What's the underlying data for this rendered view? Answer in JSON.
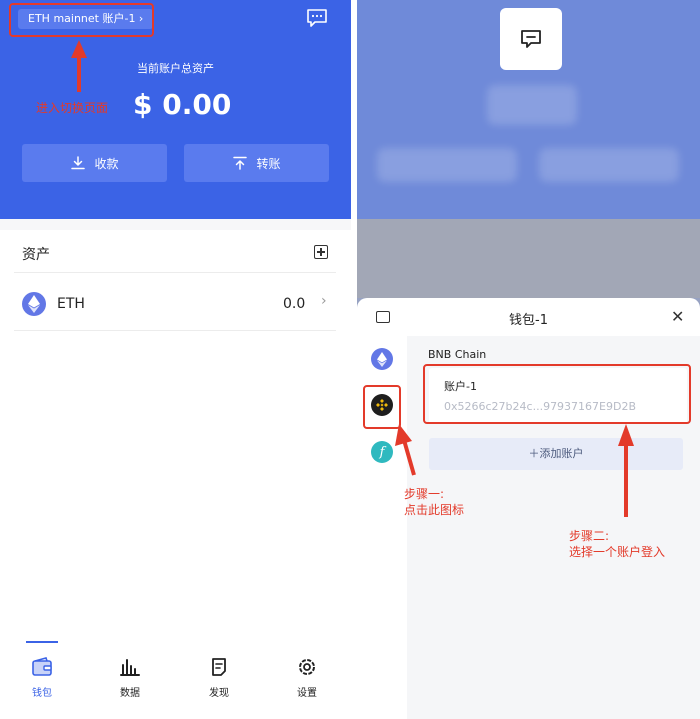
{
  "left": {
    "network_selector": "ETH mainnet 账户-1  ›",
    "total_label": "当前账户总资产",
    "total_value": "$ 0.00",
    "receive_label": "收款",
    "transfer_label": "转账",
    "assets_title": "资产",
    "assets": [
      {
        "symbol": "ETH",
        "balance": "0.0",
        "chevron": "›"
      }
    ],
    "annotation_switch": "进入切换页面",
    "tabs": [
      {
        "label": "钱包",
        "icon": "wallet-icon"
      },
      {
        "label": "数据",
        "icon": "bar-chart-icon"
      },
      {
        "label": "发现",
        "icon": "document-icon"
      },
      {
        "label": "设置",
        "icon": "gear-icon"
      }
    ],
    "accent_color": "#3b63e6",
    "annotation_color": "#e33a2a"
  },
  "right": {
    "sheet_title": "钱包-1",
    "close_glyph": "✕",
    "chains": [
      {
        "icon": "eth-chain-icon",
        "color": "#6277e6"
      },
      {
        "icon": "bnb-chain-icon",
        "color": "#1e1e1e"
      },
      {
        "icon": "fantom-chain-icon",
        "color": "#2fb9bf"
      }
    ],
    "chain_name": "BNB Chain",
    "account_name": "账户-1",
    "account_address": "0x5266c27b24c...97937167E9D2B",
    "add_account": "＋添加账户",
    "annotation_step1": "步骤一:\n点击此图标",
    "annotation_step1_line1": "步骤一:",
    "annotation_step1_line2": "点击此图标",
    "annotation_step2_line1": "步骤二:",
    "annotation_step2_line2": "选择一个账户登入"
  }
}
